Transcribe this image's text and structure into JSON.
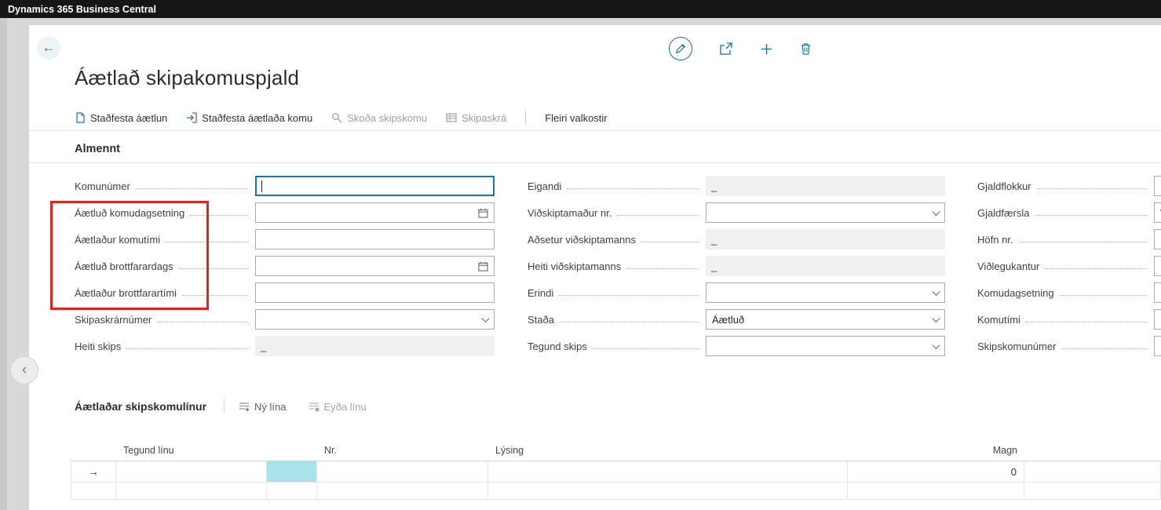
{
  "app": {
    "title": "Dynamics 365 Business Central"
  },
  "page": {
    "title": "Áætlað skipakomuspjald"
  },
  "header_icons": [
    {
      "name": "edit-pencil-icon"
    },
    {
      "name": "share-icon"
    },
    {
      "name": "new-plus-icon"
    },
    {
      "name": "delete-trash-icon"
    }
  ],
  "toolbar": {
    "items": [
      {
        "label": "Staðfesta áætlun",
        "icon": "confirm-plan-document-icon",
        "enabled": true
      },
      {
        "label": "Staðfesta áætlaða komu",
        "icon": "confirm-arrival-icon",
        "enabled": true
      },
      {
        "label": "Skoða skipskomu",
        "icon": "view-search-icon",
        "enabled": false
      },
      {
        "label": "Skipaskrá",
        "icon": "ship-register-list-icon",
        "enabled": false
      },
      {
        "label": "Fleiri valkostir",
        "icon": null,
        "enabled": true
      }
    ]
  },
  "general": {
    "title": "Almennt",
    "columns": [
      [
        {
          "label": "Komunúmer",
          "type": "text",
          "value": "",
          "focused": true
        },
        {
          "label": "Áætluð komudagsetning",
          "type": "date",
          "value": ""
        },
        {
          "label": "Áætlaður komutími",
          "type": "text",
          "value": ""
        },
        {
          "label": "Áætluð brottfarardags",
          "type": "date",
          "value": ""
        },
        {
          "label": "Áætlaður brottfarartími",
          "type": "text",
          "value": ""
        },
        {
          "label": "Skipaskrárnúmer",
          "type": "dropdown",
          "value": ""
        },
        {
          "label": "Heiti skips",
          "type": "disabled",
          "value": "_"
        }
      ],
      [
        {
          "label": "Eigandi",
          "type": "disabled",
          "value": "_"
        },
        {
          "label": "Viðskiptamaður nr.",
          "type": "dropdown",
          "value": ""
        },
        {
          "label": "Aðsetur viðskiptamanns",
          "type": "disabled",
          "value": "_"
        },
        {
          "label": "Heiti viðskiptamanns",
          "type": "disabled",
          "value": "_"
        },
        {
          "label": "Erindi",
          "type": "dropdown",
          "value": ""
        },
        {
          "label": "Staða",
          "type": "dropdown",
          "value": "Áætluð"
        },
        {
          "label": "Tegund skips",
          "type": "dropdown",
          "value": ""
        }
      ],
      [
        {
          "label": "Gjaldflokkur",
          "type": "text",
          "value": ""
        },
        {
          "label": "Gjaldfærsla",
          "type": "text",
          "value": "V"
        },
        {
          "label": "Höfn nr.",
          "type": "text",
          "value": ""
        },
        {
          "label": "Viðlegukantur",
          "type": "text",
          "value": ""
        },
        {
          "label": "Komudagsetning",
          "type": "text",
          "value": ""
        },
        {
          "label": "Komutími",
          "type": "text",
          "value": ""
        },
        {
          "label": "Skipskomunúmer",
          "type": "text",
          "value": ""
        }
      ]
    ]
  },
  "lines": {
    "title": "Áætlaðar skipskomulínur",
    "actions": [
      {
        "label": "Ný lína",
        "icon": "new-line-icon",
        "enabled": true
      },
      {
        "label": "Eyða línu",
        "icon": "delete-line-icon",
        "enabled": false
      }
    ],
    "table": {
      "columns": [
        {
          "key": "selector",
          "header": ""
        },
        {
          "key": "tegund_linu",
          "header": "Tegund línu"
        },
        {
          "key": "sel",
          "header": ""
        },
        {
          "key": "nr",
          "header": "Nr."
        },
        {
          "key": "lysing",
          "header": "Lýsing"
        },
        {
          "key": "magn",
          "header": "Magn",
          "align": "right"
        },
        {
          "key": "extra",
          "header": ""
        }
      ],
      "rows": [
        {
          "selector": "→",
          "tegund_linu": "",
          "sel": "",
          "nr": "",
          "lysing": "",
          "magn": "0",
          "extra": "",
          "selected_cell": "sel"
        },
        {
          "selector": "",
          "tegund_linu": "",
          "sel": "",
          "nr": "",
          "lysing": "",
          "magn": "",
          "extra": ""
        }
      ]
    }
  },
  "misc": {
    "back_icon": "←",
    "collapse_chevron": "‹",
    "colors": {
      "accent": "#0f6cbd",
      "annotation_red": "#e0241b",
      "selected_cell": "#a9e2e8",
      "topbar_bg": "#161616"
    }
  }
}
